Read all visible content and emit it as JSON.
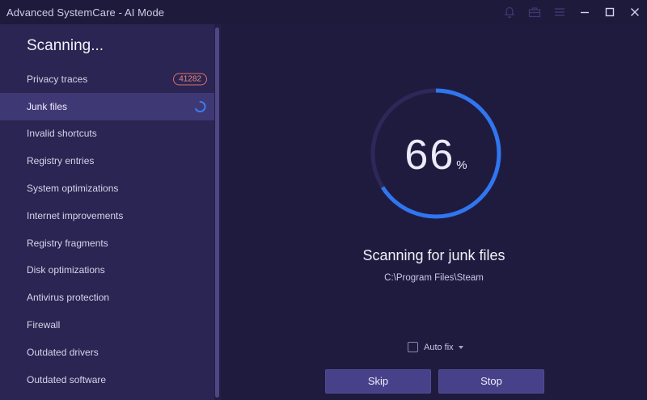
{
  "window": {
    "title": "Advanced SystemCare - AI Mode"
  },
  "titlebar_icons": [
    "bell-icon",
    "toolbox-icon",
    "menu-icon",
    "minimize-icon",
    "maximize-icon",
    "close-icon"
  ],
  "sidebar": {
    "heading": "Scanning...",
    "items": [
      {
        "label": "Privacy traces",
        "badge": "41282",
        "state": "done"
      },
      {
        "label": "Junk files",
        "state": "scanning"
      },
      {
        "label": "Invalid shortcuts",
        "state": "pending"
      },
      {
        "label": "Registry entries",
        "state": "pending"
      },
      {
        "label": "System optimizations",
        "state": "pending"
      },
      {
        "label": "Internet improvements",
        "state": "pending"
      },
      {
        "label": "Registry fragments",
        "state": "pending"
      },
      {
        "label": "Disk optimizations",
        "state": "pending"
      },
      {
        "label": "Antivirus protection",
        "state": "pending"
      },
      {
        "label": "Firewall",
        "state": "pending"
      },
      {
        "label": "Outdated drivers",
        "state": "pending"
      },
      {
        "label": "Outdated software",
        "state": "pending"
      }
    ]
  },
  "main": {
    "progress": {
      "value": "66",
      "unit": "%",
      "fraction": 0.66
    },
    "status_title": "Scanning for junk files",
    "status_path": "C:\\Program Files\\Steam",
    "auto_fix_label": "Auto fix",
    "auto_fix_checked": false,
    "skip_label": "Skip",
    "stop_label": "Stop"
  },
  "colors": {
    "accent": "#2f76f0",
    "badge": "#e0706a",
    "background": "#1f1b3f",
    "sidebar": "#2a2552"
  }
}
